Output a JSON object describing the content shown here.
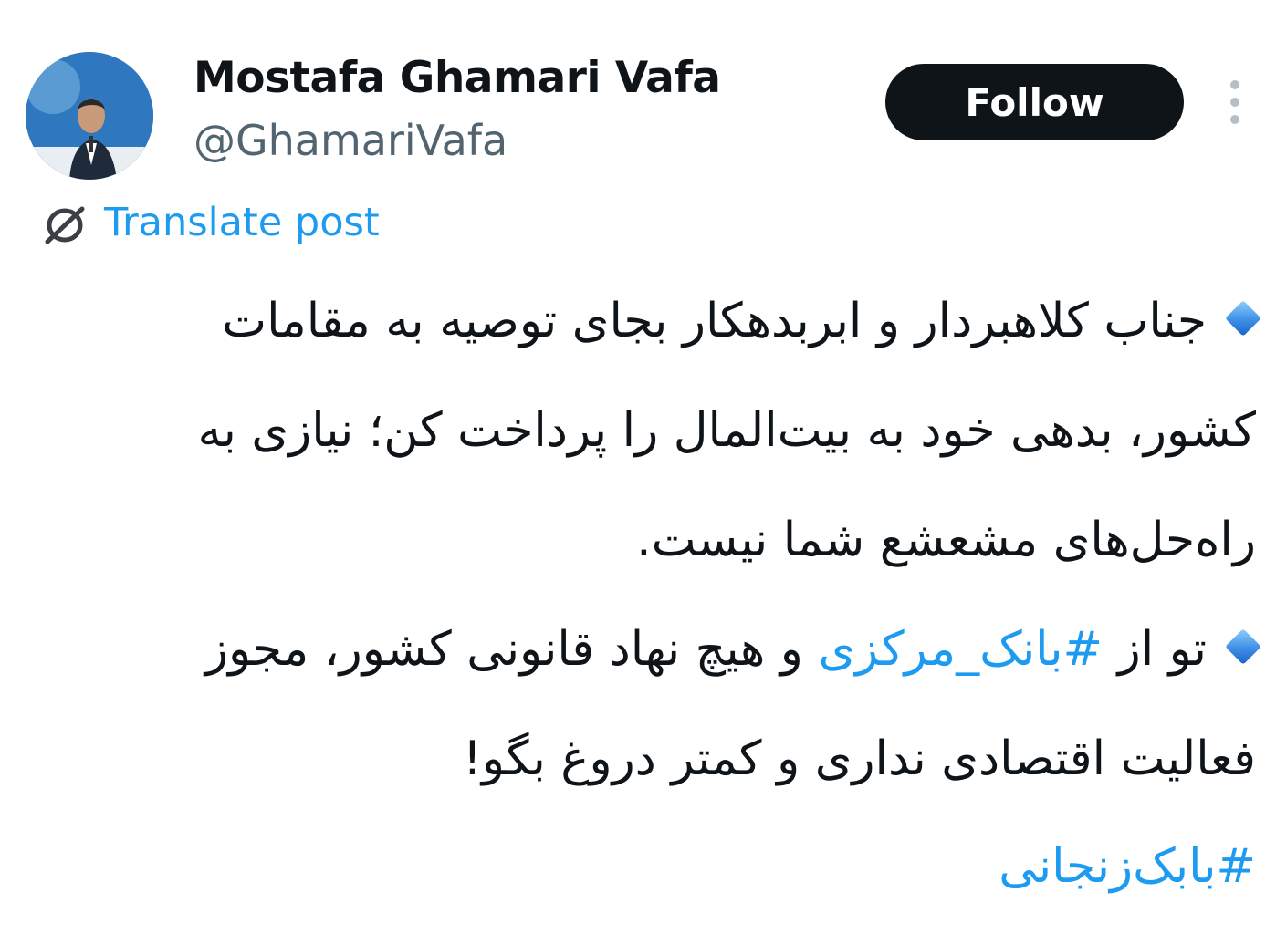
{
  "author": {
    "display_name": "Mostafa Ghamari Vafa",
    "handle": "@GhamariVafa",
    "avatar_icon": "profile-photo"
  },
  "follow_button": {
    "label": "Follow"
  },
  "more_menu": {
    "icon": "more-vertical-icon"
  },
  "translate": {
    "label": "Translate post",
    "icon": "translate-globe-icon"
  },
  "post": {
    "bullet_icon": "blue-diamond-icon",
    "line1": "جناب کلاهبردار و ابربدهکار بجای توصیه به مقامات",
    "line2": "کشور، بدهی خود به بیت‌المال را پرداخت کن؛ نیازی به",
    "line3": "راه‌حل‌های مشعشع شما نیست.",
    "line4_before": "تو از ",
    "line4_hashtag": "#بانک_مرکزی",
    "line4_after": " و هیچ نهاد قانونی کشور، مجوز",
    "line5": "فعالیت اقتصادی نداری و کمتر دروغ بگو!",
    "closing_hashtag": "#بابک‌زنجانی"
  },
  "colors": {
    "text": "#0f1419",
    "secondary": "#536471",
    "link": "#1d9bf0",
    "button_bg": "#0f1419",
    "button_text": "#ffffff"
  }
}
